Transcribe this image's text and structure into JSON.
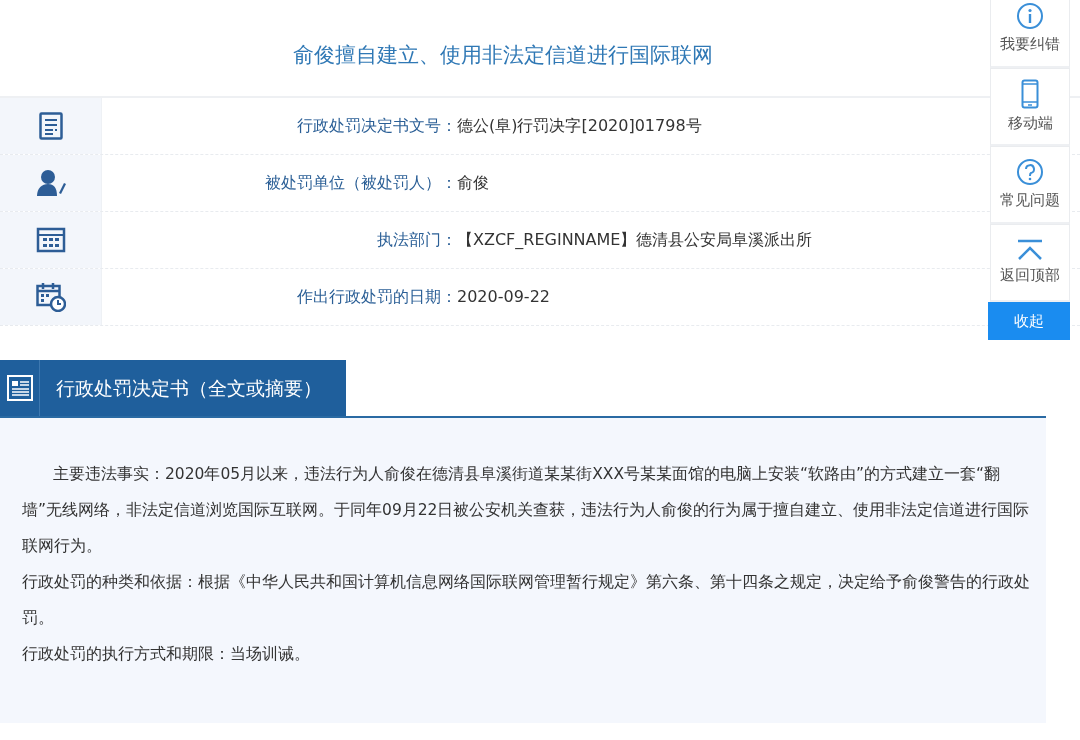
{
  "title": "俞俊擅自建立、使用非法定信道进行国际联网",
  "info_rows": [
    {
      "kind": "document",
      "label": "行政处罚决定书文号：",
      "value": "德公(阜)行罚决字[2020]01798号"
    },
    {
      "kind": "person",
      "label": "被处罚单位（被处罚人）：",
      "value": "俞俊"
    },
    {
      "kind": "building",
      "label": "执法部门：",
      "value": "【XZCF_REGINNAME】德清县公安局阜溪派出所"
    },
    {
      "kind": "calendar",
      "label": "作出行政处罚的日期：",
      "value": "2020-09-22"
    }
  ],
  "section": {
    "heading": "行政处罚决定书（全文或摘要）",
    "paragraphs": [
      {
        "indent": true,
        "text": "主要违法事实：2020年05月以来，违法行为人俞俊在德清县阜溪街道某某街XXX号某某面馆的电脑上安装“软路由”的方式建立一套“翻墙”无线网络，非法定信道浏览国际互联网。于同年09月22日被公安机关查获，违法行为人俞俊的行为属于擅自建立、使用非法定信道进行国际联网行为。"
      },
      {
        "indent": false,
        "text": "行政处罚的种类和依据：根据《中华人民共和国计算机信息网络国际联网管理暂行规定》第六条、第十四条之规定，决定给予俞俊警告的行政处罚。"
      },
      {
        "indent": false,
        "text": "行政处罚的执行方式和期限：当场训诫。"
      }
    ]
  },
  "side_panel": {
    "items": [
      {
        "kind": "info",
        "label": "我要纠错"
      },
      {
        "kind": "phone",
        "label": "移动端"
      },
      {
        "kind": "question",
        "label": "常见问题"
      },
      {
        "kind": "top",
        "label": "返回顶部"
      }
    ],
    "collapse": "收起"
  }
}
